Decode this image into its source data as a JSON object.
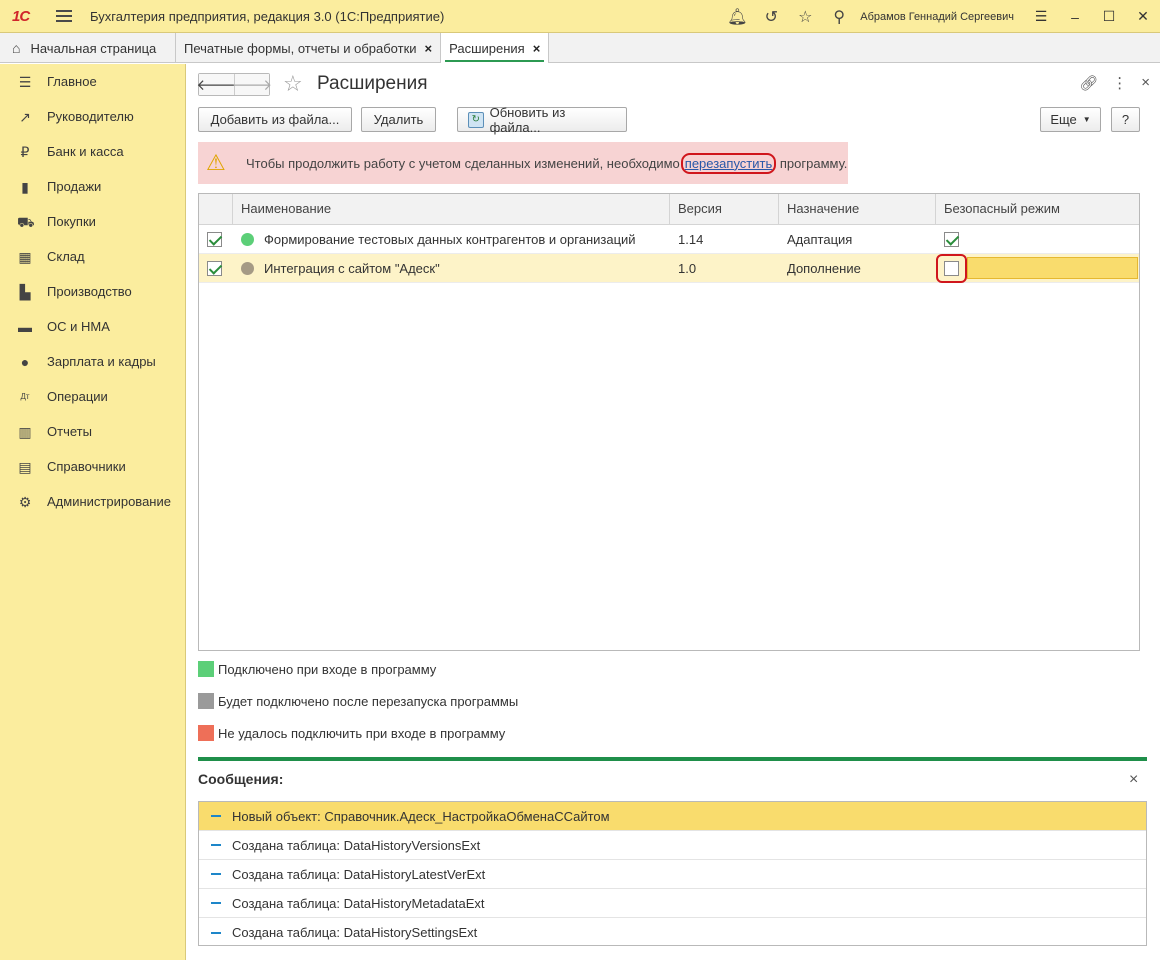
{
  "titlebar": {
    "logo": "1С",
    "app_title": "Бухгалтерия предприятия, редакция 3.0  (1С:Предприятие)",
    "user": "Абрамов Геннадий Сергеевич"
  },
  "tabs": [
    {
      "label": "Начальная страница"
    },
    {
      "label": "Печатные формы, отчеты и обработки"
    },
    {
      "label": "Расширения"
    }
  ],
  "sidebar": {
    "items": [
      {
        "label": "Главное",
        "icon": "menu-icon"
      },
      {
        "label": "Руководителю",
        "icon": "trend-icon"
      },
      {
        "label": "Банк и касса",
        "icon": "ruble-icon"
      },
      {
        "label": "Продажи",
        "icon": "bag-icon"
      },
      {
        "label": "Покупки",
        "icon": "cart-icon"
      },
      {
        "label": "Склад",
        "icon": "warehouse-icon"
      },
      {
        "label": "Производство",
        "icon": "factory-icon"
      },
      {
        "label": "ОС и НМА",
        "icon": "truck-icon"
      },
      {
        "label": "Зарплата и кадры",
        "icon": "person-icon"
      },
      {
        "label": "Операции",
        "icon": "dt-kt-icon"
      },
      {
        "label": "Отчеты",
        "icon": "bar-chart-icon"
      },
      {
        "label": "Справочники",
        "icon": "book-icon"
      },
      {
        "label": "Администрирование",
        "icon": "gear-icon"
      }
    ]
  },
  "page": {
    "title": "Расширения"
  },
  "toolbar": {
    "add_from_file": "Добавить из файла...",
    "delete": "Удалить",
    "update_from_file": "Обновить из файла...",
    "more": "Еще",
    "help": "?"
  },
  "warning": {
    "text_before": "Чтобы продолжить работу с учетом сделанных изменений, необходимо",
    "link": "перезапустить",
    "text_after": " программу."
  },
  "table": {
    "columns": [
      "Наименование",
      "Версия",
      "Назначение",
      "Безопасный режим"
    ],
    "rows": [
      {
        "enabled": true,
        "status_color": "#5ccf78",
        "name": "Формирование тестовых данных контрагентов и организаций",
        "version": "1.14",
        "purpose": "Адаптация",
        "safe_mode": true
      },
      {
        "enabled": true,
        "status_color": "#a59a85",
        "name": "Интеграция с сайтом \"Адеск\"",
        "version": "1.0",
        "purpose": "Дополнение",
        "safe_mode": false
      }
    ]
  },
  "legend": [
    {
      "color": "#5ccf78",
      "label": "Подключено при входе в программу"
    },
    {
      "color": "#9a9a9a",
      "label": "Будет подключено после перезапуска программы"
    },
    {
      "color": "#ee6f58",
      "label": "Не удалось подключить при входе в программу"
    }
  ],
  "messages": {
    "title": "Сообщения:",
    "items": [
      "Новый объект: Справочник.Адеск_НастройкаОбменаССайтом",
      "Создана таблица: DataHistoryVersionsExt",
      "Создана таблица: DataHistoryLatestVerExt",
      "Создана таблица: DataHistoryMetadataExt",
      "Создана таблица: DataHistorySettingsExt"
    ]
  }
}
